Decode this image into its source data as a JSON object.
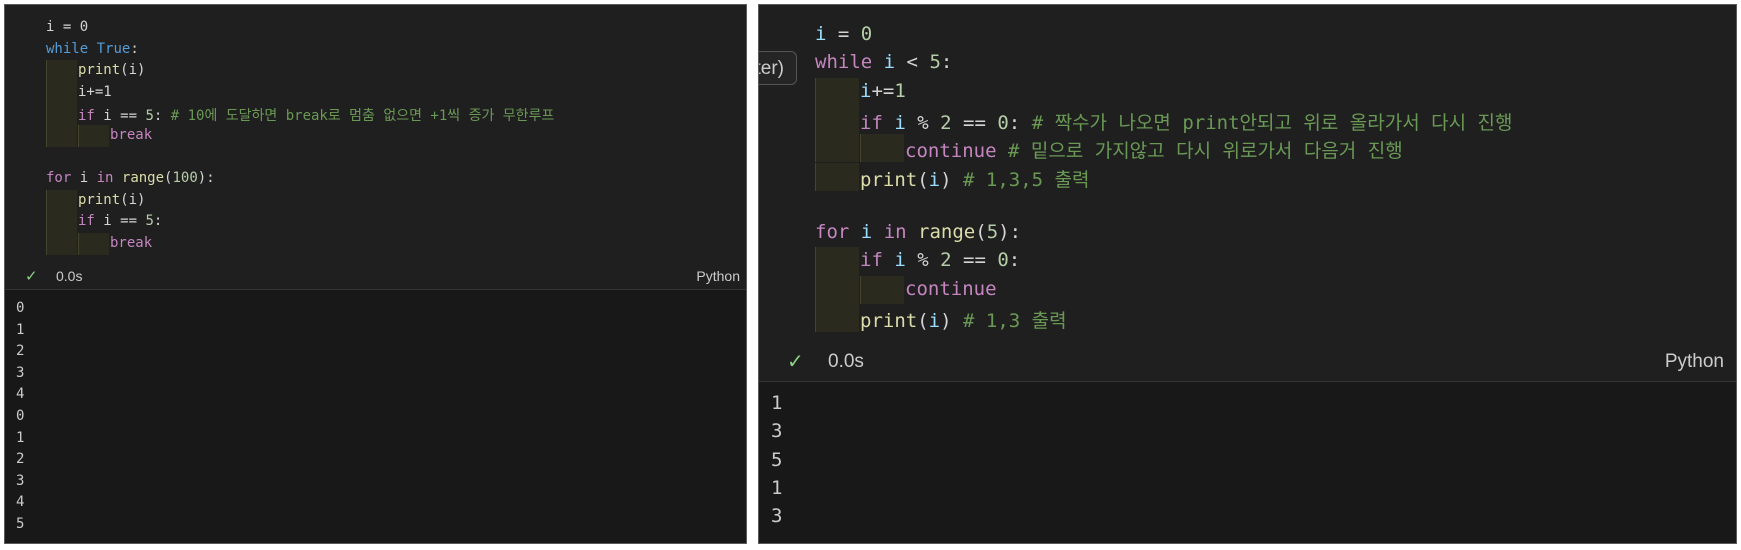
{
  "left": {
    "code": [
      [
        [
          "plain",
          "i = 0"
        ]
      ],
      [
        [
          "kw2",
          "while"
        ],
        [
          "plain",
          " "
        ],
        [
          "kw2",
          "True"
        ],
        [
          "plain",
          ":"
        ]
      ],
      [
        [
          "fn",
          "print"
        ],
        [
          "plain",
          "(i)"
        ]
      ],
      [
        [
          "plain",
          "i+=1"
        ]
      ],
      [
        [
          "kw",
          "if"
        ],
        [
          "plain",
          " i == "
        ],
        [
          "num",
          "5"
        ],
        [
          "plain",
          ": "
        ],
        [
          "cm",
          "# 10에 도달하면 break로 멈춤 없으면 +1씩 증가 무한루프"
        ]
      ],
      [
        [
          "kw",
          "break"
        ]
      ],
      [],
      [
        [
          "kw",
          "for"
        ],
        [
          "plain",
          " i "
        ],
        [
          "kw",
          "in"
        ],
        [
          "plain",
          " "
        ],
        [
          "fn",
          "range"
        ],
        [
          "plain",
          "("
        ],
        [
          "num",
          "100"
        ],
        [
          "plain",
          "):"
        ]
      ],
      [
        [
          "fn",
          "print"
        ],
        [
          "plain",
          "(i)"
        ]
      ],
      [
        [
          "kw",
          "if"
        ],
        [
          "plain",
          " i == "
        ],
        [
          "num",
          "5"
        ],
        [
          "plain",
          ":"
        ]
      ],
      [
        [
          "kw",
          "break"
        ]
      ]
    ],
    "status": {
      "check": "✓",
      "time": "0.0s",
      "language": "Python"
    },
    "output": [
      "0",
      "1",
      "2",
      "3",
      "4",
      "0",
      "1",
      "2",
      "3",
      "4",
      "5"
    ]
  },
  "right": {
    "tooltip": "ter)",
    "code": [
      [
        [
          "var",
          "i"
        ],
        [
          "plain",
          " = "
        ],
        [
          "num",
          "0"
        ]
      ],
      [
        [
          "kw",
          "while"
        ],
        [
          "plain",
          " "
        ],
        [
          "var",
          "i"
        ],
        [
          "plain",
          " < "
        ],
        [
          "num",
          "5"
        ],
        [
          "plain",
          ":"
        ]
      ],
      [
        [
          "var",
          "i"
        ],
        [
          "plain",
          "+="
        ],
        [
          "num",
          "1"
        ]
      ],
      [
        [
          "kw",
          "if"
        ],
        [
          "plain",
          " "
        ],
        [
          "var",
          "i"
        ],
        [
          "plain",
          " % "
        ],
        [
          "num",
          "2"
        ],
        [
          "plain",
          " == "
        ],
        [
          "num",
          "0"
        ],
        [
          "plain",
          ": "
        ],
        [
          "cm",
          "# 짝수가 나오면 print안되고 위로 올라가서 다시 진행"
        ]
      ],
      [
        [
          "kw",
          "continue"
        ],
        [
          "plain",
          " "
        ],
        [
          "cm",
          "# 밑으로 가지않고 다시 위로가서 다음거 진행"
        ]
      ],
      [
        [
          "fn",
          "print"
        ],
        [
          "plain",
          "("
        ],
        [
          "var",
          "i"
        ],
        [
          "plain",
          ") "
        ],
        [
          "cm",
          "# 1,3,5 출력"
        ]
      ],
      [],
      [
        [
          "kw",
          "for"
        ],
        [
          "plain",
          " "
        ],
        [
          "var",
          "i"
        ],
        [
          "plain",
          " "
        ],
        [
          "kw",
          "in"
        ],
        [
          "plain",
          " "
        ],
        [
          "fn",
          "range"
        ],
        [
          "plain",
          "("
        ],
        [
          "num",
          "5"
        ],
        [
          "plain",
          "):"
        ]
      ],
      [
        [
          "kw",
          "if"
        ],
        [
          "plain",
          " "
        ],
        [
          "var",
          "i"
        ],
        [
          "plain",
          " % "
        ],
        [
          "num",
          "2"
        ],
        [
          "plain",
          " == "
        ],
        [
          "num",
          "0"
        ],
        [
          "plain",
          ":"
        ]
      ],
      [
        [
          "kw",
          "continue"
        ]
      ],
      [
        [
          "fn",
          "print"
        ],
        [
          "plain",
          "("
        ],
        [
          "var",
          "i"
        ],
        [
          "plain",
          ") "
        ],
        [
          "cm",
          "# 1,3 출력"
        ]
      ]
    ],
    "status": {
      "check": "✓",
      "time": "0.0s",
      "language": "Python"
    },
    "output": [
      "1",
      "3",
      "5",
      "1",
      "3"
    ]
  }
}
